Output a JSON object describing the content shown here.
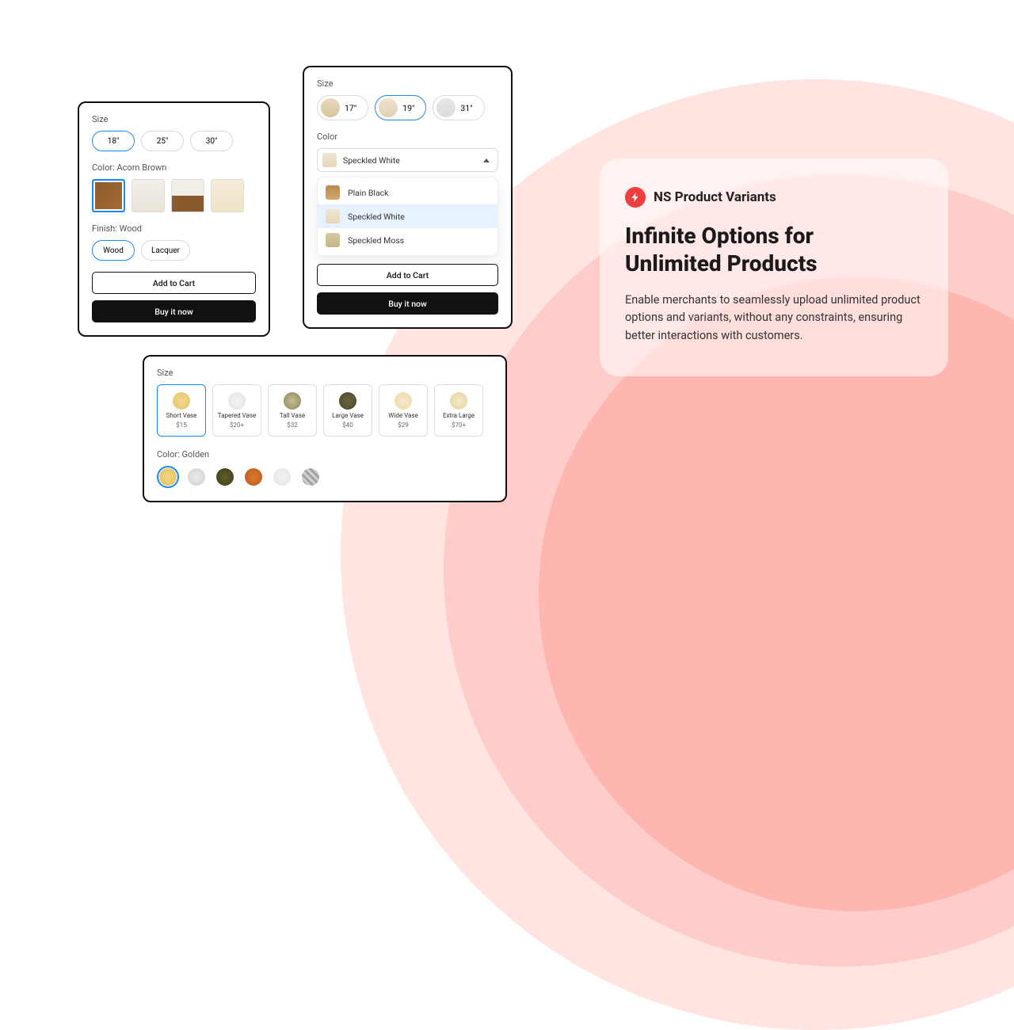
{
  "brand": {
    "name": "NS Product Variants"
  },
  "headline_l1": "Infinite Options for",
  "headline_l2": "Unlimited Products",
  "description": "Enable merchants to seamlessly upload unlimited product options and variants, without any constraints, ensuring better interactions with customers.",
  "card_a": {
    "size_label": "Size",
    "sizes": [
      "18\"",
      "25\"",
      "30\""
    ],
    "size_selected": 0,
    "color_label": "Color: Acorn Brown",
    "swatches": [
      {
        "name": "Acorn Brown",
        "bg": "linear-gradient(135deg,#8a5a2c,#a66a33)"
      },
      {
        "name": "White",
        "bg": "linear-gradient(#f2efe9,#e9e4d9)"
      },
      {
        "name": "Two-tone",
        "bg": "linear-gradient(#f2efe9 50%,#8a5a2c 50%)"
      },
      {
        "name": "Cream",
        "bg": "linear-gradient(#f4ecd9,#efe3c6)"
      }
    ],
    "swatch_selected": 0,
    "finish_label": "Finish: Wood",
    "finishes": [
      "Wood",
      "Lacquer"
    ],
    "finish_selected": 0,
    "add_label": "Add to Cart",
    "buy_label": "Buy it now"
  },
  "card_b": {
    "size_label": "Size",
    "sizes": [
      {
        "label": "17\"",
        "bg": "linear-gradient(#e9d9bf,#d8c39a)"
      },
      {
        "label": "19\"",
        "bg": "linear-gradient(#f0e2cc,#e0d1b4)"
      },
      {
        "label": "31\"",
        "bg": "linear-gradient(#e6e6e6,#dcdcdc)"
      }
    ],
    "size_selected": 1,
    "color_label": "Color",
    "dd_selected": "Speckled White",
    "menu": [
      {
        "label": "Plain Black",
        "bg": "linear-gradient(#b98a52,#d1a86c)"
      },
      {
        "label": "Speckled White",
        "bg": "linear-gradient(#efe5d2,#e6d7b9)"
      },
      {
        "label": "Speckled Moss",
        "bg": "linear-gradient(#d8cba6,#c4b583)"
      }
    ],
    "menu_highlight": 1,
    "add_label": "Add to Cart",
    "buy_label": "Buy it now"
  },
  "card_c": {
    "size_label": "Size",
    "tiles": [
      {
        "name": "Short Vase",
        "price": "$15",
        "bg": "radial-gradient(circle,#f2d693,#e8c566)"
      },
      {
        "name": "Tapered Vase",
        "price": "$20+",
        "bg": "radial-gradient(circle,#f4f4f4,#e2e2e2)"
      },
      {
        "name": "Tall Vase",
        "price": "$32",
        "bg": "radial-gradient(circle,#c4bf99,#8a8652)"
      },
      {
        "name": "Large Vase",
        "price": "$40",
        "bg": "radial-gradient(circle,#6b6640,#4a4628)"
      },
      {
        "name": "Wide Vase",
        "price": "$29",
        "bg": "radial-gradient(circle,#f6e9cc,#eed9a3)"
      },
      {
        "name": "Extra Large",
        "price": "$70+",
        "bg": "radial-gradient(circle,#f3e8c9,#e8d59a)"
      }
    ],
    "tile_selected": 0,
    "color_label": "Color: Golden",
    "circles": [
      {
        "name": "Golden",
        "bg": "radial-gradient(circle,#f4d98b,#e2bd4f)"
      },
      {
        "name": "Silver",
        "bg": "radial-gradient(circle,#eaeaea,#cfcfcf)"
      },
      {
        "name": "Olive",
        "bg": "radial-gradient(circle,#5f5d2b,#3e3d18)"
      },
      {
        "name": "Copper",
        "bg": "radial-gradient(circle,#d97a2e,#b85a14)"
      },
      {
        "name": "White",
        "bg": "radial-gradient(circle,#f2f2f2,#e3e3e3)"
      },
      {
        "name": "Striped",
        "bg": "repeating-linear-gradient(45deg,#cfcfcf 0 3px,#a0a0a0 3px 6px)"
      }
    ],
    "circle_selected": 0
  }
}
